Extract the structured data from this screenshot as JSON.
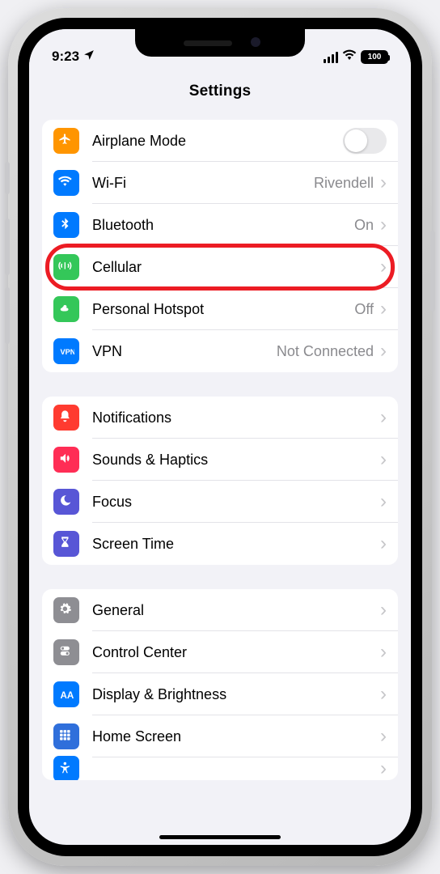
{
  "status": {
    "time": "9:23",
    "battery": "100"
  },
  "title": "Settings",
  "groups": [
    {
      "rows": [
        {
          "icon": "airplane-icon",
          "bg": "bg-orange",
          "label": "Airplane Mode",
          "toggle": true
        },
        {
          "icon": "wifi-icon",
          "bg": "bg-blue",
          "label": "Wi-Fi",
          "value": "Rivendell",
          "chevron": true
        },
        {
          "icon": "bluetooth-icon",
          "bg": "bg-blue",
          "label": "Bluetooth",
          "value": "On",
          "chevron": true
        },
        {
          "icon": "cellular-icon",
          "bg": "bg-green",
          "label": "Cellular",
          "chevron": true,
          "highlight": true
        },
        {
          "icon": "hotspot-icon",
          "bg": "bg-green",
          "label": "Personal Hotspot",
          "value": "Off",
          "chevron": true
        },
        {
          "icon": "vpn-icon",
          "bg": "bg-bluev",
          "label": "VPN",
          "value": "Not Connected",
          "chevron": true
        }
      ]
    },
    {
      "rows": [
        {
          "icon": "notifications-icon",
          "bg": "bg-red",
          "label": "Notifications",
          "chevron": true
        },
        {
          "icon": "sounds-icon",
          "bg": "bg-pink",
          "label": "Sounds & Haptics",
          "chevron": true
        },
        {
          "icon": "focus-icon",
          "bg": "bg-indigo",
          "label": "Focus",
          "chevron": true
        },
        {
          "icon": "screentime-icon",
          "bg": "bg-indigo",
          "label": "Screen Time",
          "chevron": true
        }
      ]
    },
    {
      "rows": [
        {
          "icon": "general-icon",
          "bg": "bg-gray",
          "label": "General",
          "chevron": true
        },
        {
          "icon": "controlcenter-icon",
          "bg": "bg-gray",
          "label": "Control Center",
          "chevron": true
        },
        {
          "icon": "display-icon",
          "bg": "bg-blue",
          "label": "Display & Brightness",
          "chevron": true
        },
        {
          "icon": "homescreen-icon",
          "bg": "bg-royal",
          "label": "Home Screen",
          "chevron": true
        },
        {
          "icon": "accessibility-icon",
          "bg": "bg-blue",
          "label": "",
          "chevron": true,
          "partial": true
        }
      ]
    }
  ]
}
